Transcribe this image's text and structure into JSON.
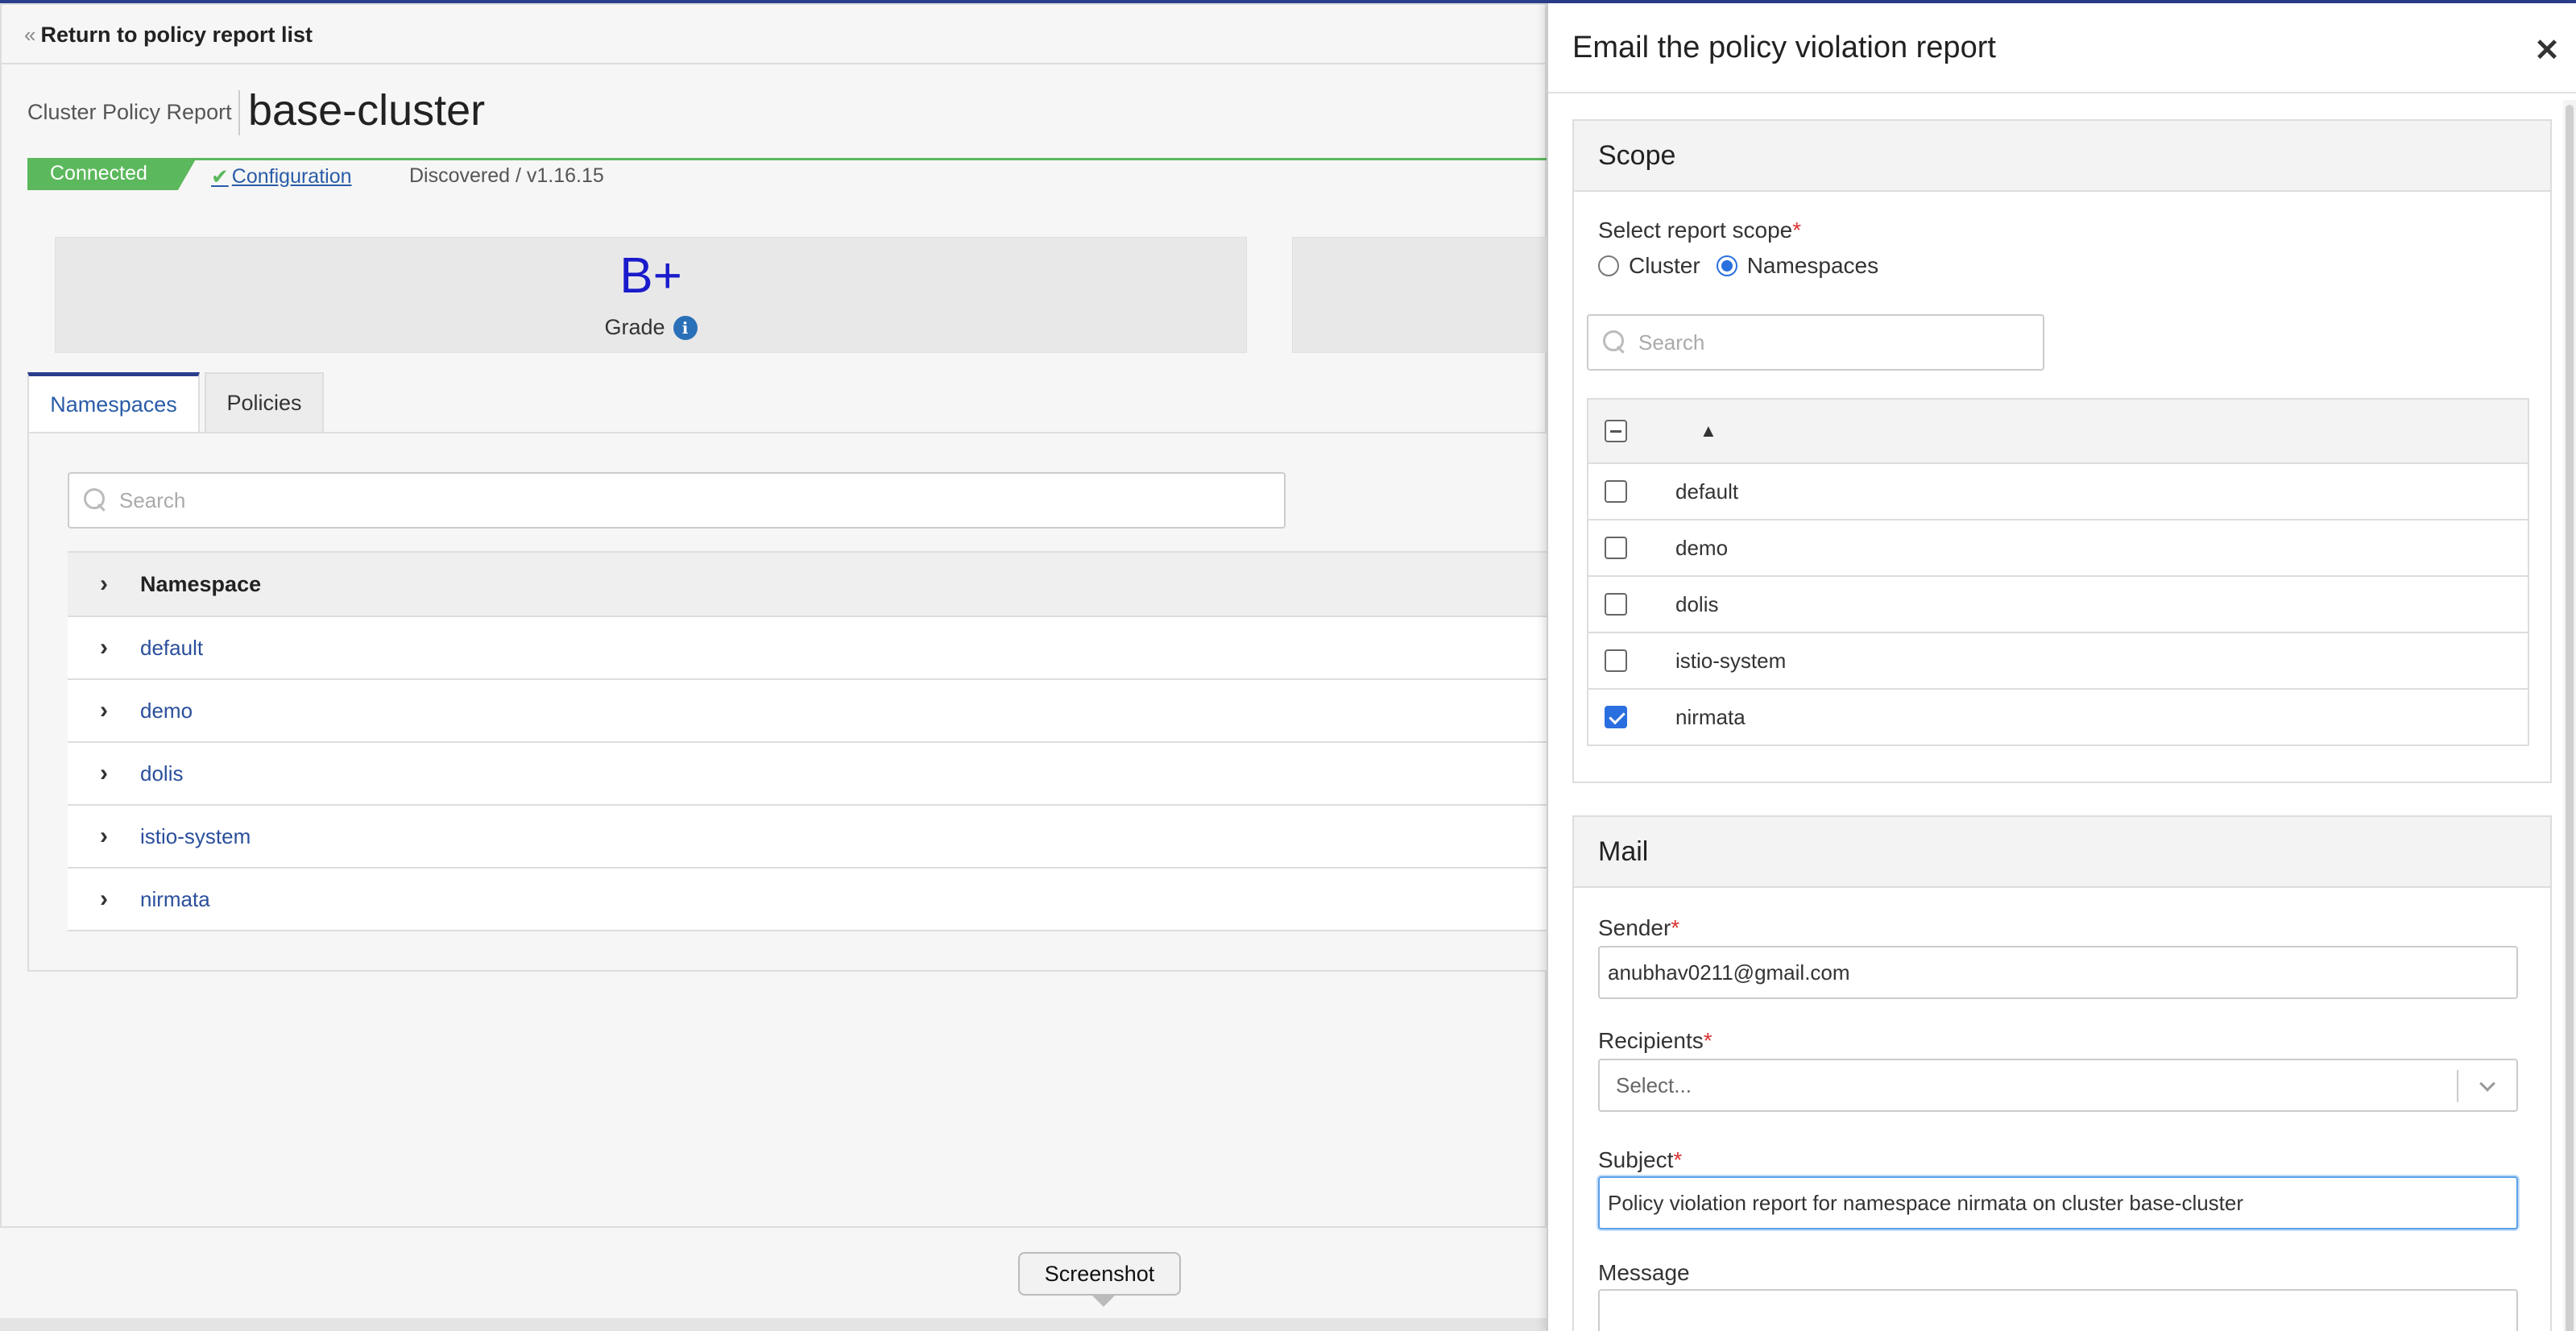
{
  "main": {
    "back_label": "Return to policy report list",
    "crumb_label": "Cluster Policy Report",
    "cluster_name": "base-cluster",
    "status": "Connected",
    "config_link": "Configuration",
    "discovered": "Discovered / v1.16.15",
    "grade_value": "B+",
    "grade_label": "Grade",
    "tabs": [
      {
        "label": "Namespaces",
        "active": true
      },
      {
        "label": "Policies",
        "active": false
      }
    ],
    "search_placeholder": "Search",
    "table": {
      "header": "Namespace",
      "rows": [
        "default",
        "demo",
        "dolis",
        "istio-system",
        "nirmata"
      ]
    }
  },
  "screenshot_label": "Screenshot",
  "drawer": {
    "title": "Email the policy violation report",
    "scope": {
      "heading": "Scope",
      "label": "Select report scope",
      "options": [
        "Cluster",
        "Namespaces"
      ],
      "selected": "Namespaces",
      "search_placeholder": "Search",
      "namespaces": [
        {
          "name": "default",
          "checked": false
        },
        {
          "name": "demo",
          "checked": false
        },
        {
          "name": "dolis",
          "checked": false
        },
        {
          "name": "istio-system",
          "checked": false
        },
        {
          "name": "nirmata",
          "checked": true
        }
      ]
    },
    "mail": {
      "heading": "Mail",
      "sender_label": "Sender",
      "sender_value": "anubhav0211@gmail.com",
      "recipients_label": "Recipients",
      "recipients_placeholder": "Select...",
      "subject_label": "Subject",
      "subject_value": "Policy violation report for namespace nirmata on cluster base-cluster",
      "message_label": "Message"
    }
  },
  "colors": {
    "accent": "#2a3e8c",
    "link": "#2a4f9c",
    "connected": "#5cb85c",
    "grade": "#1a1acc",
    "required": "#dd3333",
    "checkbox": "#2a6fe0"
  }
}
